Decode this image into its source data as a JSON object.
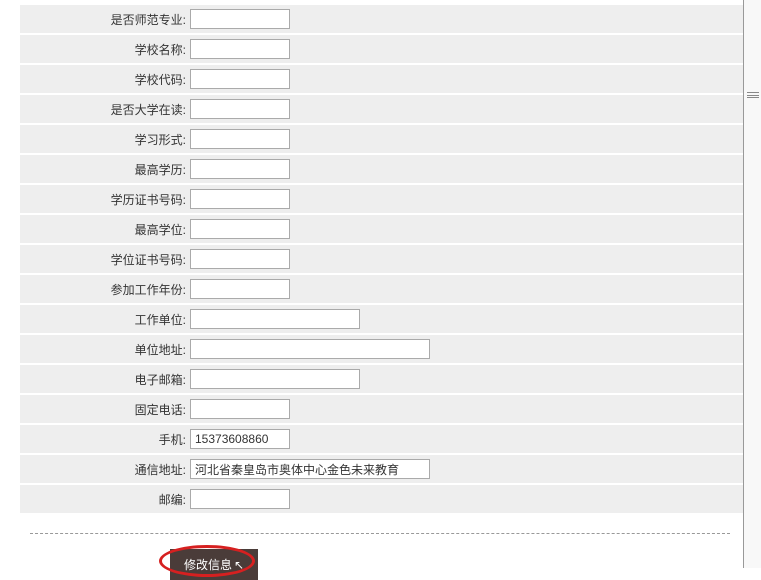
{
  "form": {
    "rows": [
      {
        "name": "is-normal-major",
        "label": "是否师范专业",
        "value": "",
        "width": "sm"
      },
      {
        "name": "school-name",
        "label": "学校名称",
        "value": "",
        "width": "sm"
      },
      {
        "name": "school-code",
        "label": "学校代码",
        "value": "",
        "width": "sm"
      },
      {
        "name": "is-university-current",
        "label": "是否大学在读",
        "value": "",
        "width": "sm"
      },
      {
        "name": "study-form",
        "label": "学习形式",
        "value": "",
        "width": "sm"
      },
      {
        "name": "highest-education",
        "label": "最高学历",
        "value": "",
        "width": "sm"
      },
      {
        "name": "education-cert-no",
        "label": "学历证书号码",
        "value": "",
        "width": "sm"
      },
      {
        "name": "highest-degree",
        "label": "最高学位",
        "value": "",
        "width": "sm"
      },
      {
        "name": "degree-cert-no",
        "label": "学位证书号码",
        "value": "",
        "width": "sm"
      },
      {
        "name": "work-start-year",
        "label": "参加工作年份",
        "value": "",
        "width": "sm"
      },
      {
        "name": "work-unit",
        "label": "工作单位",
        "value": "",
        "width": "md"
      },
      {
        "name": "unit-address",
        "label": "单位地址",
        "value": "",
        "width": "lg"
      },
      {
        "name": "email",
        "label": "电子邮箱",
        "value": "",
        "width": "md"
      },
      {
        "name": "fixed-phone",
        "label": "固定电话",
        "value": "",
        "width": "sm"
      },
      {
        "name": "mobile",
        "label": "手机",
        "value": "15373608860",
        "width": "sm",
        "black": true
      },
      {
        "name": "mail-address",
        "label": "通信地址",
        "value": "河北省秦皇岛市奥体中心金色未来教育",
        "width": "lg",
        "black": true
      },
      {
        "name": "postcode",
        "label": "邮编",
        "value": "",
        "width": "sm"
      }
    ]
  },
  "button": {
    "submit_label": "修改信息"
  }
}
